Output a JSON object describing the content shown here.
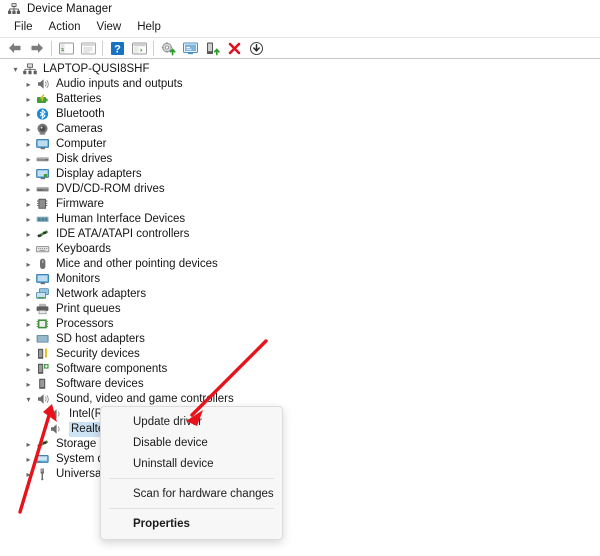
{
  "window": {
    "title": "Device Manager",
    "app_icon": "device-manager-icon"
  },
  "menubar": {
    "items": [
      {
        "label": "File"
      },
      {
        "label": "Action"
      },
      {
        "label": "View"
      },
      {
        "label": "Help"
      }
    ]
  },
  "toolbar": {
    "buttons": [
      {
        "name": "back-button",
        "icon": "back-arrow-icon",
        "tooltip": "Back"
      },
      {
        "name": "forward-button",
        "icon": "forward-arrow-icon",
        "tooltip": "Forward"
      },
      {
        "name": "show-hide-console-tree-button",
        "icon": "console-tree-icon",
        "tooltip": "Show/Hide Console Tree"
      },
      {
        "name": "properties-button",
        "icon": "properties-window-icon",
        "tooltip": "Properties"
      },
      {
        "name": "help-button",
        "icon": "help-question-icon",
        "tooltip": "Help"
      },
      {
        "name": "show-hide-action-pane-button",
        "icon": "action-pane-icon",
        "tooltip": "Show/Hide Action Pane"
      },
      {
        "name": "update-driver-button",
        "icon": "update-driver-gear-icon",
        "tooltip": "Update driver"
      },
      {
        "name": "scan-hardware-changes-button",
        "icon": "scan-monitor-icon",
        "tooltip": "Scan for hardware changes"
      },
      {
        "name": "disable-device-button",
        "icon": "disable-device-icon",
        "tooltip": "Disable device"
      },
      {
        "name": "uninstall-device-button",
        "icon": "uninstall-red-x-icon",
        "tooltip": "Uninstall device"
      },
      {
        "name": "download-button",
        "icon": "download-circle-arrow-icon",
        "tooltip": "Download"
      }
    ]
  },
  "tree": {
    "root": {
      "label": "LAPTOP-QUSI8SHF",
      "icon": "computer-node-icon",
      "expanded": true,
      "chevron": "expanded"
    },
    "items": [
      {
        "label": "Audio inputs and outputs",
        "icon": "speaker-icon",
        "chevron": "collapsed",
        "depth": 1
      },
      {
        "label": "Batteries",
        "icon": "battery-icon",
        "chevron": "collapsed",
        "depth": 1
      },
      {
        "label": "Bluetooth",
        "icon": "bluetooth-icon",
        "chevron": "collapsed",
        "depth": 1
      },
      {
        "label": "Cameras",
        "icon": "camera-icon",
        "chevron": "collapsed",
        "depth": 1
      },
      {
        "label": "Computer",
        "icon": "monitor-icon",
        "chevron": "collapsed",
        "depth": 1
      },
      {
        "label": "Disk drives",
        "icon": "disk-drive-icon",
        "chevron": "collapsed",
        "depth": 1
      },
      {
        "label": "Display adapters",
        "icon": "display-adapter-icon",
        "chevron": "collapsed",
        "depth": 1
      },
      {
        "label": "DVD/CD-ROM drives",
        "icon": "dvd-drive-icon",
        "chevron": "collapsed",
        "depth": 1
      },
      {
        "label": "Firmware",
        "icon": "firmware-chip-icon",
        "chevron": "collapsed",
        "depth": 1
      },
      {
        "label": "Human Interface Devices",
        "icon": "hid-icon",
        "chevron": "collapsed",
        "depth": 1
      },
      {
        "label": "IDE ATA/ATAPI controllers",
        "icon": "ide-controller-icon",
        "chevron": "collapsed",
        "depth": 1
      },
      {
        "label": "Keyboards",
        "icon": "keyboard-icon",
        "chevron": "collapsed",
        "depth": 1
      },
      {
        "label": "Mice and other pointing devices",
        "icon": "mouse-icon",
        "chevron": "collapsed",
        "depth": 1
      },
      {
        "label": "Monitors",
        "icon": "monitor-icon",
        "chevron": "collapsed",
        "depth": 1
      },
      {
        "label": "Network adapters",
        "icon": "network-adapter-icon",
        "chevron": "collapsed",
        "depth": 1
      },
      {
        "label": "Print queues",
        "icon": "printer-icon",
        "chevron": "collapsed",
        "depth": 1
      },
      {
        "label": "Processors",
        "icon": "processor-icon",
        "chevron": "collapsed",
        "depth": 1
      },
      {
        "label": "SD host adapters",
        "icon": "sd-adapter-icon",
        "chevron": "collapsed",
        "depth": 1
      },
      {
        "label": "Security devices",
        "icon": "security-device-icon",
        "chevron": "collapsed",
        "depth": 1
      },
      {
        "label": "Software components",
        "icon": "software-component-icon",
        "chevron": "collapsed",
        "depth": 1
      },
      {
        "label": "Software devices",
        "icon": "software-device-icon",
        "chevron": "collapsed",
        "depth": 1
      },
      {
        "label": "Sound, video and game controllers",
        "icon": "speaker-icon",
        "chevron": "expanded",
        "depth": 1
      },
      {
        "label": "Intel(R) Display Audio",
        "icon": "speaker-icon",
        "chevron": "none",
        "depth": 2
      },
      {
        "label": "Realtek(R) Audio",
        "icon": "speaker-icon",
        "chevron": "none",
        "depth": 2,
        "selected": true
      },
      {
        "label": "Storage controllers",
        "icon": "storage-controller-icon",
        "chevron": "collapsed",
        "depth": 1
      },
      {
        "label": "System devices",
        "icon": "system-device-icon",
        "chevron": "collapsed",
        "depth": 1
      },
      {
        "label": "Universal Serial Bus controllers",
        "icon": "usb-icon",
        "chevron": "collapsed",
        "depth": 1
      }
    ]
  },
  "context_menu": {
    "items": [
      {
        "label": "Update driver",
        "type": "item",
        "bold": false
      },
      {
        "label": "Disable device",
        "type": "item",
        "bold": false
      },
      {
        "label": "Uninstall device",
        "type": "item",
        "bold": false
      },
      {
        "type": "separator"
      },
      {
        "label": "Scan for hardware changes",
        "type": "item",
        "bold": false
      },
      {
        "type": "separator"
      },
      {
        "label": "Properties",
        "type": "item",
        "bold": true
      }
    ]
  },
  "annotations": {
    "arrow_color": "#e8131a",
    "arrows": [
      {
        "name": "arrow-to-update-driver",
        "points_to": "Update driver"
      },
      {
        "name": "arrow-to-realtek-audio",
        "points_to": "Realtek(R) Audio"
      }
    ]
  },
  "colors": {
    "selection": "#cce3f5",
    "menu_background": "#f7f7f7",
    "toolbar_border": "#c8c8c8",
    "accent_red": "#e8131a"
  }
}
